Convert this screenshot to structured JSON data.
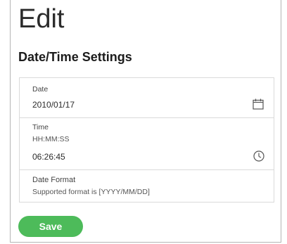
{
  "page": {
    "title": "Edit",
    "section_title": "Date/Time Settings"
  },
  "date": {
    "label": "Date",
    "value": "2010/01/17",
    "icon": "calendar-icon"
  },
  "time": {
    "label": "Time",
    "hint": "HH:MM:SS",
    "value": "06:26:45",
    "icon": "clock-icon"
  },
  "date_format": {
    "label": "Date Format",
    "hint": "Supported format is [YYYY/MM/DD]"
  },
  "actions": {
    "save_label": "Save"
  },
  "colors": {
    "save_button": "#4dbb5a",
    "border": "#dadada"
  }
}
